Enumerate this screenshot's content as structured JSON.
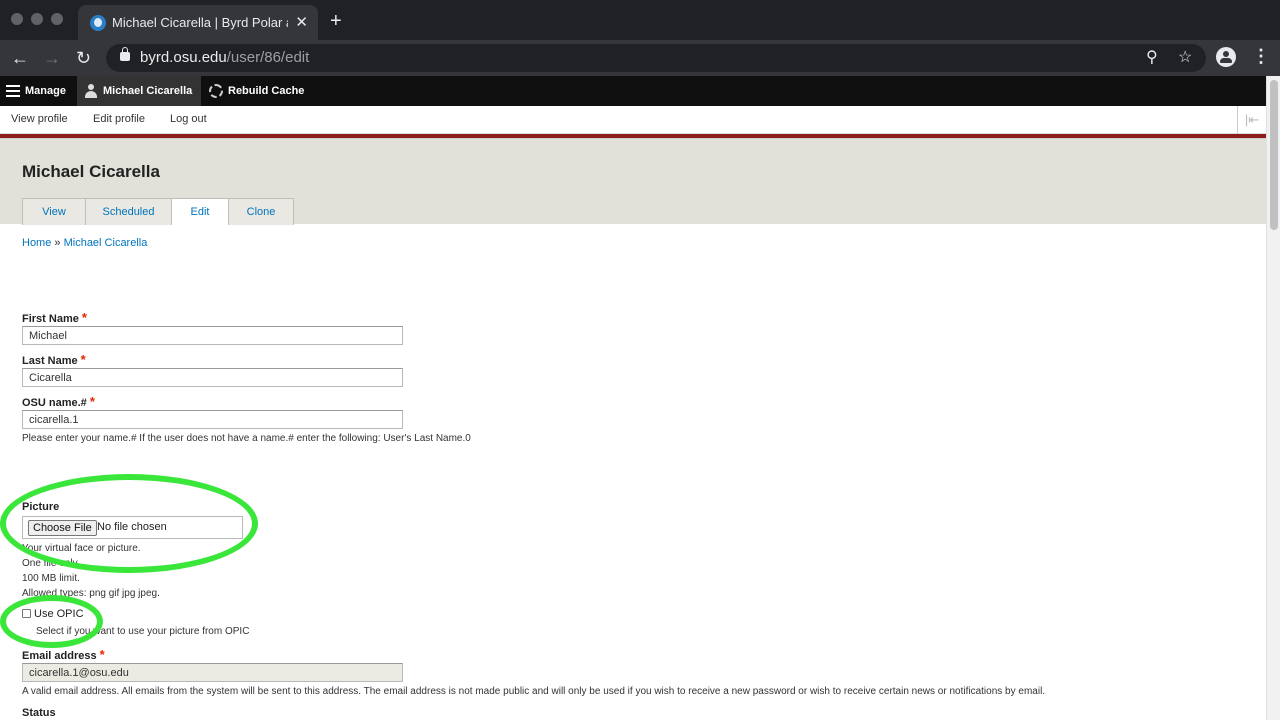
{
  "browser": {
    "tab_title": "Michael Cicarella | Byrd Polar a",
    "tab_close": "✕",
    "new_tab": "+",
    "url_host": "byrd.osu.edu",
    "url_path": "/user/86/edit",
    "back": "←",
    "forward": "→",
    "reload": "↻",
    "zoom": "⚲",
    "bookmark": "☆",
    "menu": "⋮"
  },
  "toolbar": {
    "manage": "Manage",
    "user": "Michael Cicarella",
    "rebuild": "Rebuild Cache"
  },
  "subtoolbar": {
    "view_profile": "View profile",
    "edit_profile": "Edit profile",
    "log_out": "Log out",
    "orientation": "|⇤"
  },
  "page": {
    "title": "Michael Cicarella",
    "tabs": [
      "View",
      "Scheduled",
      "Edit",
      "Clone"
    ],
    "active_tab": "Edit",
    "breadcrumb": {
      "home": "Home",
      "sep": "»",
      "current": "Michael Cicarella"
    }
  },
  "form": {
    "first_name": {
      "label": "First Name",
      "value": "Michael"
    },
    "last_name": {
      "label": "Last Name",
      "value": "Cicarella"
    },
    "osu_name": {
      "label": "OSU name.#",
      "value": "cicarella.1",
      "description": "Please enter your name.# If the user does not have a name.# enter the following: User's Last Name.0"
    },
    "picture": {
      "label": "Picture",
      "button": "Choose File",
      "status": "No file chosen",
      "desc1": "Your virtual face or picture.",
      "desc2": "One file only.",
      "desc3": "100 MB limit.",
      "desc4": "Allowed types: png gif jpg jpeg."
    },
    "use_opic": {
      "label": "Use OPIC",
      "checked": false,
      "description": "Select if you want to use your picture from OPIC"
    },
    "email": {
      "label": "Email address",
      "value": "cicarella.1@osu.edu",
      "description": "A valid email address. All emails from the system will be sent to this address. The email address is not made public and will only be used if you wish to receive a new password or wish to receive certain news or notifications by email."
    },
    "status": {
      "label": "Status"
    },
    "required_mark": "*"
  },
  "colors": {
    "highlight": "#39e639",
    "link": "#0074bd",
    "accent_red": "#8c1d1d",
    "required": "#e32700"
  }
}
